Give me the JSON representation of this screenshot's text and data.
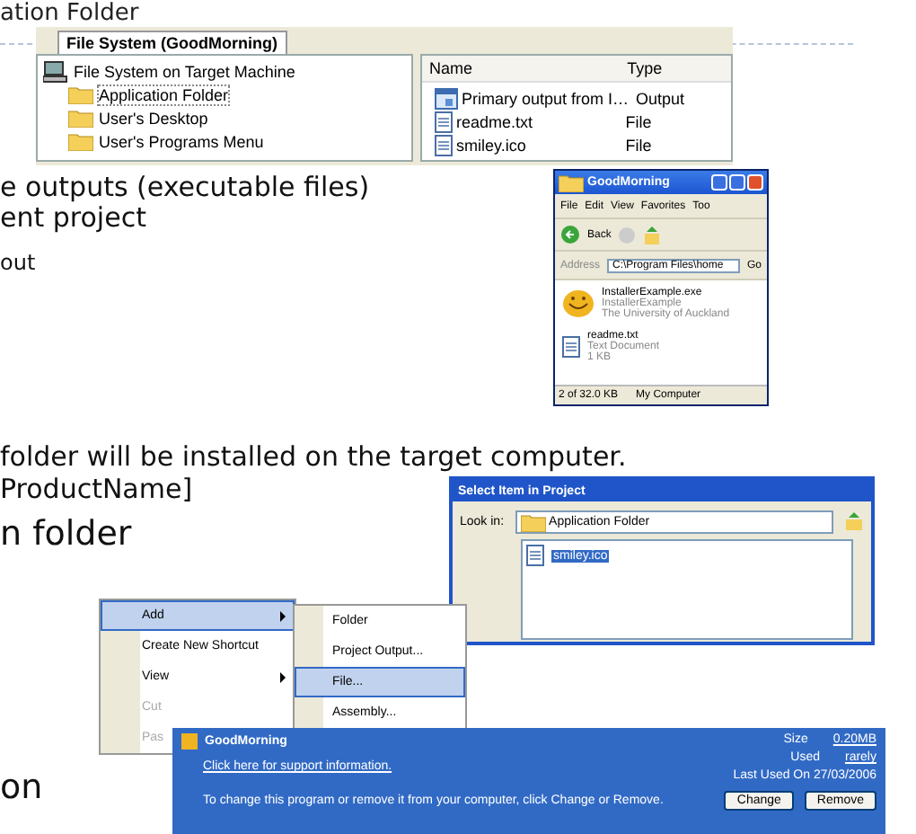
{
  "slide_title": "ation Folder",
  "bullets": [
    {
      "text": "e outputs (executable files)",
      "kind": "sub"
    },
    {
      "text": "ent project",
      "kind": "sub"
    },
    {
      "text": "out",
      "kind": "minor"
    },
    {
      "text": "folder will be installed on the target computer.",
      "kind": "sub"
    },
    {
      "text": "ProductName]",
      "kind": "sub"
    },
    {
      "text": "n folder",
      "kind": "main"
    },
    {
      "text": "on",
      "kind": "main"
    }
  ],
  "file_system": {
    "tab": "File System (GoodMorning)",
    "root": "File System on Target Machine",
    "folders": [
      {
        "label": "Application Folder",
        "selected": true
      },
      {
        "label": "User's Desktop",
        "selected": false
      },
      {
        "label": "User's Programs Menu",
        "selected": false
      }
    ],
    "columns": [
      "Name",
      "Type"
    ],
    "rows": [
      {
        "name": "Primary output from I…",
        "type": "Output",
        "kind": "output"
      },
      {
        "name": "readme.txt",
        "type": "File",
        "kind": "file"
      },
      {
        "name": "smiley.ico",
        "type": "File",
        "kind": "file"
      }
    ]
  },
  "explorer": {
    "title": "GoodMorning",
    "menu": [
      "File",
      "Edit",
      "View",
      "Favorites",
      "Too"
    ],
    "back": "Back",
    "address_label": "Address",
    "address": "C:\\Program Files\\home",
    "go": "Go",
    "items": [
      {
        "kind": "smiley",
        "name": "InstallerExample.exe",
        "lines": [
          "InstallerExample",
          "The University of Auckland"
        ]
      },
      {
        "kind": "document",
        "name": "readme.txt",
        "lines": [
          "Text Document",
          "1 KB"
        ]
      }
    ],
    "status": "2 of 32.0 KB",
    "zone": "My Computer"
  },
  "select_dialog": {
    "title": "Select Item in Project",
    "look_in_label": "Look in:",
    "look_in": "Application Folder",
    "files": [
      {
        "name": "smiley.ico",
        "selected": true
      }
    ]
  },
  "context_menu": {
    "items": [
      {
        "label": "Add",
        "selected": true,
        "submenu": true,
        "disabled": false
      },
      {
        "label": "Create New Shortcut",
        "selected": false,
        "submenu": false,
        "disabled": false
      },
      {
        "label": "View",
        "selected": false,
        "submenu": true,
        "disabled": false
      },
      {
        "label": "Cut",
        "selected": false,
        "submenu": false,
        "disabled": true
      },
      {
        "label": "Pas",
        "selected": false,
        "submenu": false,
        "disabled": true
      }
    ],
    "submenu": [
      {
        "label": "Folder",
        "selected": false
      },
      {
        "label": "Project Output...",
        "selected": false
      },
      {
        "label": "File...",
        "selected": true
      },
      {
        "label": "Assembly...",
        "selected": false
      }
    ]
  },
  "add_remove": {
    "name": "GoodMorning",
    "support_link": "Click here for support information.",
    "size_label": "Size",
    "size": "0.20MB",
    "used_label": "Used",
    "used": "rarely",
    "last_used": "Last Used On 27/03/2006",
    "hint": "To change this program or remove it from your computer, click Change or Remove.",
    "buttons": [
      "Change",
      "Remove"
    ]
  }
}
